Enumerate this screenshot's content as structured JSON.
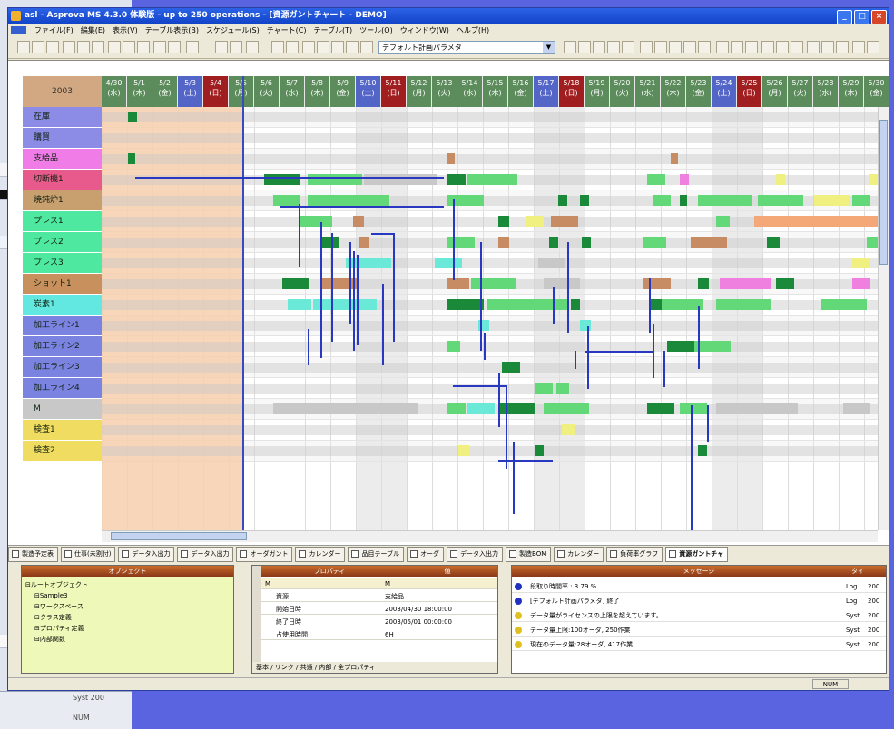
{
  "window": {
    "title": "asl - Asprova MS 4.3.0 体験版 - up to 250 operations - [資源ガントチャート - DEMO]"
  },
  "menu": [
    "ファイル(F)",
    "編集(E)",
    "表示(V)",
    "テーブル表示(B)",
    "スケジュール(S)",
    "チャート(C)",
    "テーブル(T)",
    "ツール(O)",
    "ウィンドウ(W)",
    "ヘルプ(H)"
  ],
  "toolbar": {
    "parameter_combo": "デフォルト計画パラメタ"
  },
  "gantt": {
    "corner_label": "2003",
    "dates": [
      {
        "d": "4/30",
        "w": "(水)",
        "type": "pre"
      },
      {
        "d": "5/1",
        "w": "(木)",
        "type": "pre"
      },
      {
        "d": "5/2",
        "w": "(金)",
        "type": "pre"
      },
      {
        "d": "5/3",
        "w": "(土)",
        "type": "sat"
      },
      {
        "d": "5/4",
        "w": "(日)",
        "type": "sun"
      },
      {
        "d": "5/5",
        "w": "(月)",
        "type": "wk"
      },
      {
        "d": "5/6",
        "w": "(火)",
        "type": "wk"
      },
      {
        "d": "5/7",
        "w": "(水)",
        "type": "wk"
      },
      {
        "d": "5/8",
        "w": "(木)",
        "type": "wk"
      },
      {
        "d": "5/9",
        "w": "(金)",
        "type": "wk"
      },
      {
        "d": "5/10",
        "w": "(土)",
        "type": "sat"
      },
      {
        "d": "5/11",
        "w": "(日)",
        "type": "sun"
      },
      {
        "d": "5/12",
        "w": "(月)",
        "type": "wk"
      },
      {
        "d": "5/13",
        "w": "(火)",
        "type": "wk"
      },
      {
        "d": "5/14",
        "w": "(水)",
        "type": "wk"
      },
      {
        "d": "5/15",
        "w": "(木)",
        "type": "wk"
      },
      {
        "d": "5/16",
        "w": "(金)",
        "type": "wk"
      },
      {
        "d": "5/17",
        "w": "(土)",
        "type": "sat"
      },
      {
        "d": "5/18",
        "w": "(日)",
        "type": "sun"
      },
      {
        "d": "5/19",
        "w": "(月)",
        "type": "wk"
      },
      {
        "d": "5/20",
        "w": "(火)",
        "type": "wk"
      },
      {
        "d": "5/21",
        "w": "(水)",
        "type": "wk"
      },
      {
        "d": "5/22",
        "w": "(木)",
        "type": "wk"
      },
      {
        "d": "5/23",
        "w": "(金)",
        "type": "wk"
      },
      {
        "d": "5/24",
        "w": "(土)",
        "type": "sat"
      },
      {
        "d": "5/25",
        "w": "(日)",
        "type": "sun"
      },
      {
        "d": "5/26",
        "w": "(月)",
        "type": "wk"
      },
      {
        "d": "5/27",
        "w": "(火)",
        "type": "wk"
      },
      {
        "d": "5/28",
        "w": "(水)",
        "type": "wk"
      },
      {
        "d": "5/29",
        "w": "(木)",
        "type": "wk"
      },
      {
        "d": "5/30",
        "w": "(金)",
        "type": "wk"
      }
    ],
    "resources": [
      {
        "name": "在庫",
        "color": "#8c8ce6"
      },
      {
        "name": "購買",
        "color": "#8c8ce6"
      },
      {
        "name": "支給品",
        "color": "#f07ce8"
      },
      {
        "name": "切断機1",
        "color": "#e85a8c"
      },
      {
        "name": "焼鈍炉1",
        "color": "#c8a070"
      },
      {
        "name": "プレス1",
        "color": "#4ee8a0"
      },
      {
        "name": "プレス2",
        "color": "#4ee8a0"
      },
      {
        "name": "プレス3",
        "color": "#4ee8a0"
      },
      {
        "name": "ショット1",
        "color": "#c8905c"
      },
      {
        "name": "炭素1",
        "color": "#62e8e0"
      },
      {
        "name": "加工ライン1",
        "color": "#7a84e0"
      },
      {
        "name": "加工ライン2",
        "color": "#7a84e0"
      },
      {
        "name": "加工ライン3",
        "color": "#7a84e0"
      },
      {
        "name": "加工ライン4",
        "color": "#7a84e0"
      },
      {
        "name": "M",
        "color": "#c8c8c8"
      },
      {
        "name": "検査1",
        "color": "#f0dc60"
      },
      {
        "name": "検査2",
        "color": "#f0dc60"
      }
    ]
  },
  "tabs": [
    "製造予定表",
    "仕事(未割付)",
    "データ入出力",
    "データ入出力",
    "オーダガント",
    "カレンダー",
    "品目テーブル",
    "オーダ",
    "データ入出力",
    "製造BOM",
    "カレンダー",
    "負荷率グラフ",
    "資源ガントチャ"
  ],
  "object_panel": {
    "header": "オブジェクト",
    "items": [
      "ルートオブジェクト",
      "Sample3",
      "ワークスペース",
      "クラス定義",
      "プロパティ定義",
      "内部関数"
    ]
  },
  "property_panel": {
    "header_name": "プロパティ",
    "header_value": "値",
    "rows": [
      {
        "name": "M",
        "value": "M"
      },
      {
        "name": "資源",
        "value": "支給品"
      },
      {
        "name": "開始日時",
        "value": "2003/04/30 18:00:00"
      },
      {
        "name": "終了日時",
        "value": "2003/05/01 00:00:00"
      },
      {
        "name": "占使用時間",
        "value": "6H"
      }
    ],
    "tabs": "基本 / リンク / 共通 / 内部 / 全プロパティ"
  },
  "message_panel": {
    "header": "メッセージ",
    "col_type": "タイ",
    "rows": [
      {
        "text": "段取り時間率 : 3.79 %",
        "type": "Log",
        "val": "200",
        "color": "#2030c0"
      },
      {
        "text": "[デフォルト計画パラメタ] 終了",
        "type": "Log",
        "val": "200",
        "color": "#2030c0"
      },
      {
        "text": "データ量がライセンスの上限を超えています。",
        "type": "Syst",
        "val": "200",
        "color": "#e0c020"
      },
      {
        "text": "データ量上限:100オーダ, 250作業",
        "type": "Syst",
        "val": "200",
        "color": "#e0c020"
      },
      {
        "text": "現在のデータ量:28オーダ, 417作業",
        "type": "Syst",
        "val": "200",
        "color": "#e0c020"
      }
    ]
  },
  "status": {
    "num": "NUM"
  },
  "background_app": {
    "syst": "Syst 200",
    "num": "NUM"
  }
}
